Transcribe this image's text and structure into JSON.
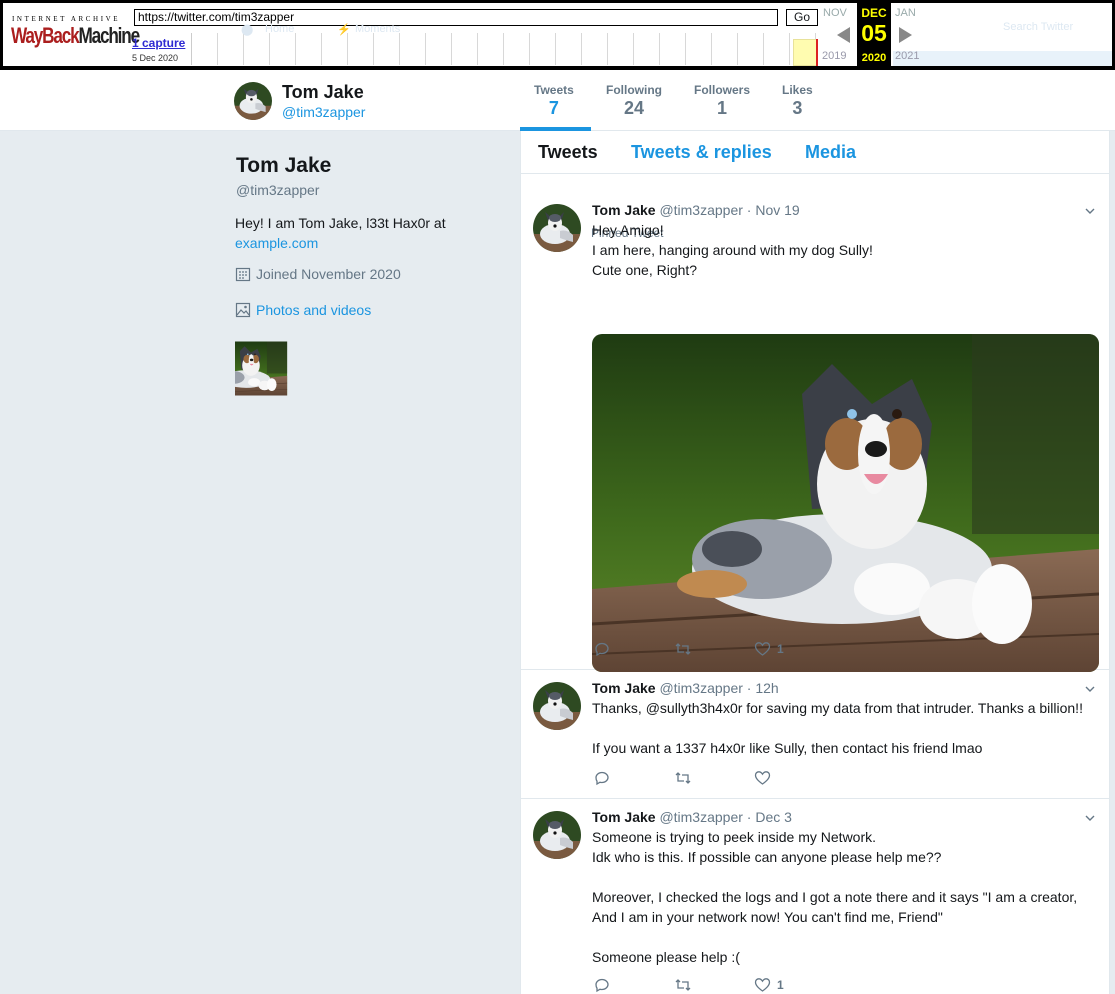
{
  "wayback": {
    "logo_top": "INTERNET ARCHIVE",
    "logo_wayback": "WayBack",
    "logo_machine": "Machine",
    "url": "https://twitter.com/tim3zapper",
    "go_label": "Go",
    "captures_label": "1 capture",
    "capture_date": "5 Dec 2020",
    "prev_month": "NOV",
    "prev_year": "2019",
    "cur_month": "DEC",
    "cur_day": "05",
    "cur_year": "2020",
    "next_month": "JAN",
    "next_year": "2021",
    "ghost_home": "Home",
    "ghost_moments": "Moments",
    "ghost_search": "Search Twitter"
  },
  "profile_nav": {
    "name": "Tom Jake",
    "handle": "@tim3zapper",
    "stats": [
      {
        "label": "Tweets",
        "value": "7"
      },
      {
        "label": "Following",
        "value": "24"
      },
      {
        "label": "Followers",
        "value": "1"
      },
      {
        "label": "Likes",
        "value": "3"
      }
    ]
  },
  "profile": {
    "name": "Tom Jake",
    "handle": "@tim3zapper",
    "bio_text": "Hey! I am Tom Jake, l33t Hax0r at",
    "bio_link": "example.com",
    "joined": "Joined November 2020",
    "photos_label": "Photos and videos"
  },
  "tabs": [
    "Tweets",
    "Tweets & replies",
    "Media"
  ],
  "tweets": [
    {
      "pinned_label": "Pinned Tweet",
      "name": "Tom Jake",
      "handle": "@tim3zapper",
      "time": "· Nov 19",
      "lines": [
        "Hey Amigo!",
        "I am here, hanging around with my dog Sully!",
        "Cute one, Right?"
      ],
      "likes": "1"
    },
    {
      "name": "Tom Jake",
      "handle": "@tim3zapper",
      "time": "· 12h",
      "lines": [
        "Thanks, @sullyth3h4x0r for saving my data from that intruder. Thanks a billion!!",
        "",
        "If you want a 1337 h4x0r like Sully, then contact his friend lmao"
      ],
      "likes": ""
    },
    {
      "name": "Tom Jake",
      "handle": "@tim3zapper",
      "time": "· Dec 3",
      "lines": [
        "Someone is trying to peek inside my Network.",
        "Idk who is this. If possible can anyone please help me??",
        "",
        "Moreover, I checked the logs and I got a note there and it says \"I am a creator,",
        "And I am in your network now! You can't find me, Friend\"",
        "",
        "Someone please help :("
      ],
      "likes": "1"
    }
  ],
  "colors": {
    "accent": "#1b95e0",
    "background": "#e6ecf0",
    "muted": "#657786"
  }
}
